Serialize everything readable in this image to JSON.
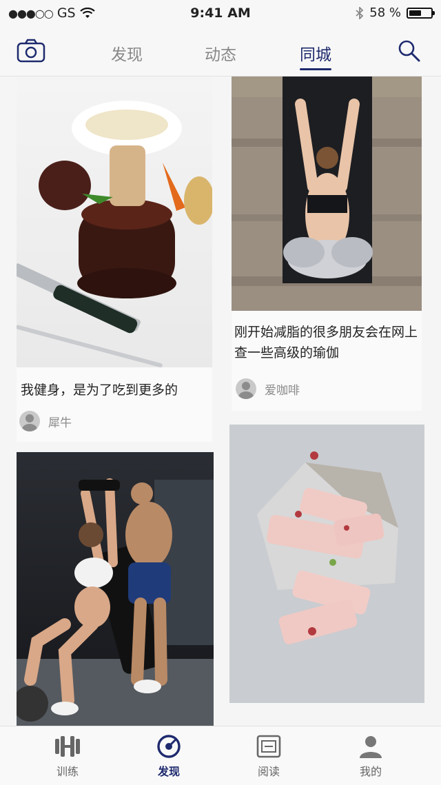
{
  "status_bar": {
    "signal": "●●●○○",
    "carrier": "GS",
    "time": "9:41 AM",
    "battery_text": "58 %",
    "battery_level": 0.58
  },
  "top_nav": {
    "tabs": [
      {
        "label": "发现",
        "active": false
      },
      {
        "label": "动态",
        "active": false
      },
      {
        "label": "同城",
        "active": true
      }
    ]
  },
  "feed": {
    "cards": [
      {
        "title": "我健身，是为了吃到更多的",
        "author": "犀牛"
      },
      {
        "title": "刚开始减脂的很多朋友会在网上查一些高级的瑜伽",
        "author": "爱咖啡"
      },
      {
        "title": "",
        "author": ""
      },
      {
        "title": "",
        "author": ""
      }
    ]
  },
  "bottom_tabs": [
    {
      "label": "训练",
      "icon": "dumbbell-icon",
      "active": false
    },
    {
      "label": "发现",
      "icon": "compass-icon",
      "active": true
    },
    {
      "label": "阅读",
      "icon": "reader-icon",
      "active": false
    },
    {
      "label": "我的",
      "icon": "profile-icon",
      "active": false
    }
  ],
  "colors": {
    "accent": "#1e2a6e",
    "inactive": "#888888"
  }
}
